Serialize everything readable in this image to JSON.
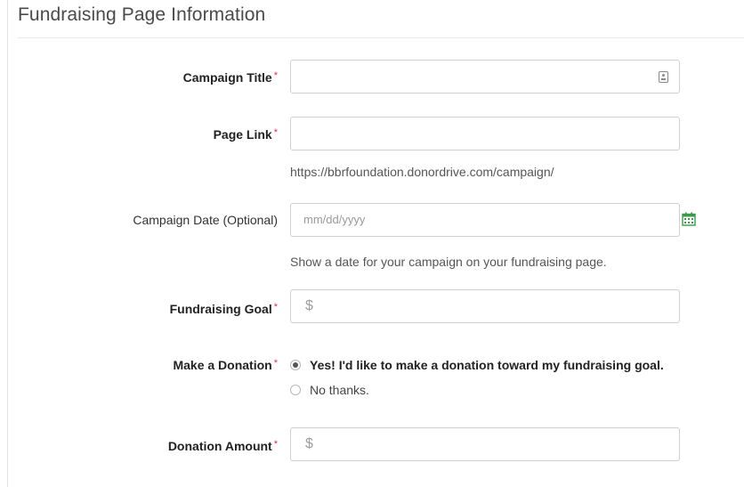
{
  "section": {
    "title": "Fundraising Page Information"
  },
  "fields": {
    "campaign_title": {
      "label": "Campaign Title",
      "required_mark": "*",
      "value": ""
    },
    "page_link": {
      "label": "Page Link",
      "required_mark": "*",
      "value": "",
      "help": "https://bbrfoundation.donordrive.com/campaign/"
    },
    "campaign_date": {
      "label": "Campaign Date (Optional)",
      "placeholder": "mm/dd/yyyy",
      "help": "Show a date for your campaign on your fundraising page.",
      "icon": "calendar-icon"
    },
    "fundraising_goal": {
      "label": "Fundraising Goal",
      "required_mark": "*",
      "prefix": "$"
    },
    "make_donation": {
      "label": "Make a Donation",
      "required_mark": "*",
      "options": [
        {
          "label": "Yes! I'd like to make a donation toward my fundraising goal.",
          "selected": true
        },
        {
          "label": "No thanks.",
          "selected": false
        }
      ]
    },
    "donation_amount": {
      "label": "Donation Amount",
      "required_mark": "*",
      "prefix": "$"
    }
  },
  "colors": {
    "required": "#d9364b",
    "calendar_icon": "#3a9a4a",
    "border": "#cfcfcf"
  }
}
